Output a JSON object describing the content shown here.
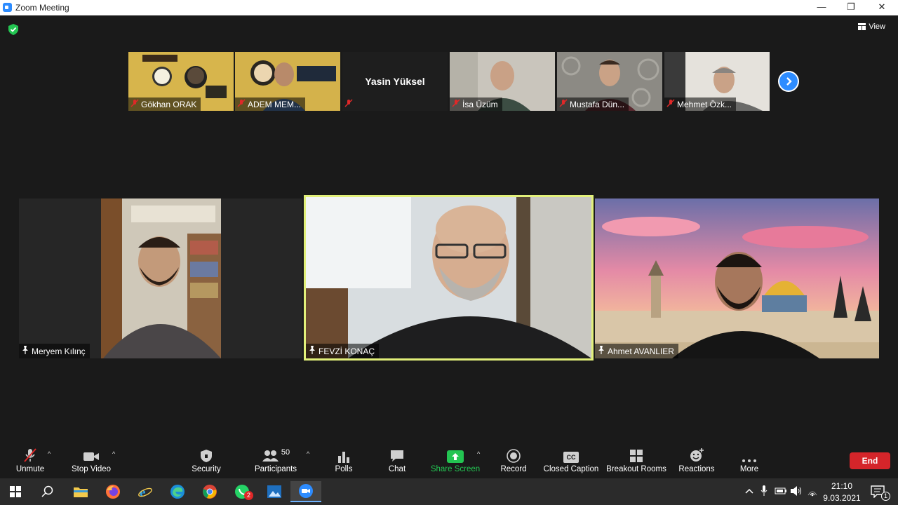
{
  "window": {
    "title": "Zoom Meeting",
    "minimize": "—",
    "restore": "❐",
    "close": "✕"
  },
  "meeting": {
    "view_label": "View",
    "security_status": "encrypted"
  },
  "gallery_strip": [
    {
      "name": "Gökhan ORAK",
      "muted": true
    },
    {
      "name": "ADEM MEM...",
      "muted": true
    },
    {
      "name": "",
      "center_name": "Yasin Yüksel",
      "muted": true
    },
    {
      "name": "İsa Üzüm",
      "muted": true
    },
    {
      "name": "Mustafa Dün...",
      "muted": true
    },
    {
      "name": "Mehmet Özk...",
      "muted": true
    }
  ],
  "main_tiles": [
    {
      "name": "Meryem Kılınç",
      "pinned": true
    },
    {
      "name": "FEVZİ KONAÇ",
      "pinned": true,
      "active_speaker": true
    },
    {
      "name": "Ahmet AVANLIER",
      "pinned": true
    }
  ],
  "toolbar": {
    "unmute": "Unmute",
    "stop_video": "Stop Video",
    "security": "Security",
    "participants": "Participants",
    "participants_count": "50",
    "polls": "Polls",
    "chat": "Chat",
    "share_screen": "Share Screen",
    "record": "Record",
    "closed_caption": "Closed Caption",
    "breakout_rooms": "Breakout Rooms",
    "reactions": "Reactions",
    "more": "More",
    "end": "End",
    "cc_glyph": "CC"
  },
  "taskbar": {
    "time": "21:10",
    "date": "9.03.2021",
    "whatsapp_badge": "2",
    "notification_count": "1"
  },
  "colors": {
    "accent_blue": "#2d8cff",
    "active_speaker_border": "#e2f07a",
    "share_green": "#23c552",
    "end_red": "#d4252a",
    "muted_red": "#e02828"
  }
}
